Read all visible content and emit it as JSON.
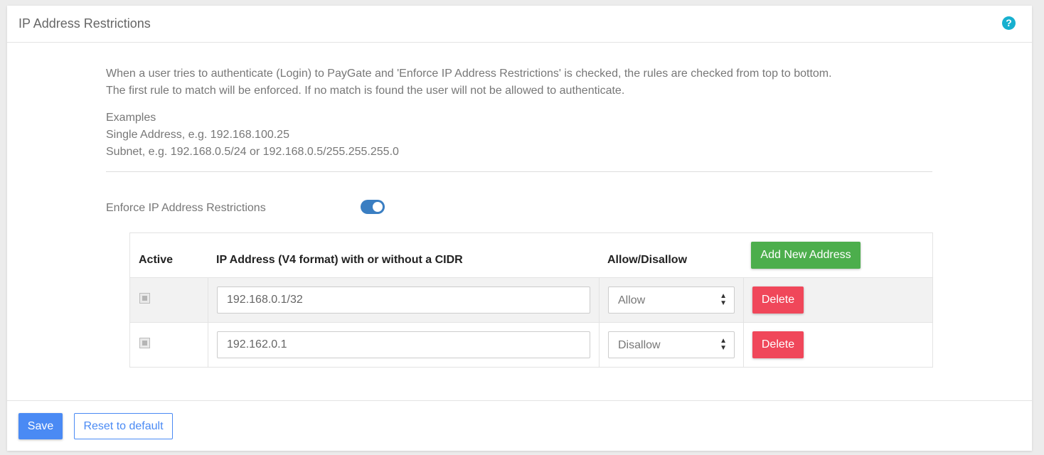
{
  "card": {
    "title": "IP Address Restrictions",
    "help_icon": "?"
  },
  "description": {
    "line1": "When a user tries to authenticate (Login) to PayGate and 'Enforce IP Address Restrictions' is checked, the rules are checked from top to bottom.",
    "line2": "The first rule to match will be enforced. If no match is found the user will not be allowed to authenticate."
  },
  "examples": {
    "heading": "Examples",
    "single": "Single Address, e.g. 192.168.100.25",
    "subnet": "Subnet, e.g. 192.168.0.5/24 or 192.168.0.5/255.255.255.0"
  },
  "enforce": {
    "label": "Enforce IP Address Restrictions",
    "enabled": true
  },
  "table": {
    "headers": {
      "active": "Active",
      "ip": "IP Address (V4 format) with or without a CIDR",
      "allow": "Allow/Disallow"
    },
    "add_button": "Add New Address",
    "rows": [
      {
        "active": true,
        "ip": "192.168.0.1/32",
        "allow": "Allow",
        "delete": "Delete"
      },
      {
        "active": true,
        "ip": "192.162.0.1",
        "allow": "Disallow",
        "delete": "Delete"
      }
    ]
  },
  "footer": {
    "save": "Save",
    "reset": "Reset to default"
  }
}
